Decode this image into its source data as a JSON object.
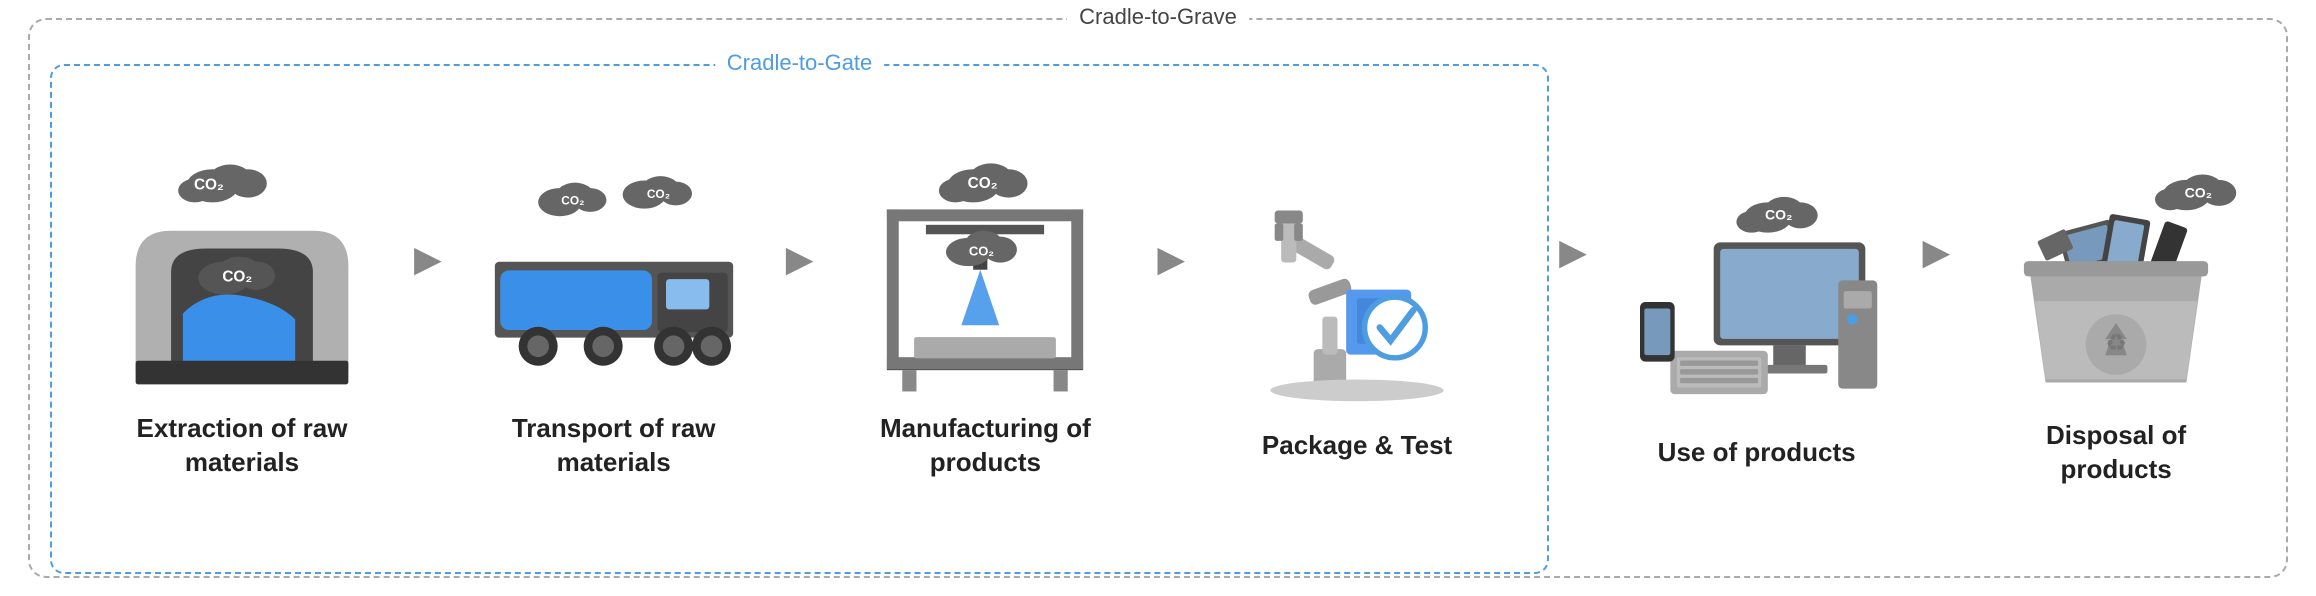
{
  "diagram": {
    "outer_label": "Cradle-to-Grave",
    "inner_label": "Cradle-to-Gate",
    "stages": [
      {
        "id": "extraction",
        "label": "Extraction of raw\nmaterials",
        "inside_gate": true
      },
      {
        "id": "transport",
        "label": "Transport of raw\nmaterials",
        "inside_gate": true
      },
      {
        "id": "manufacturing",
        "label": "Manufacturing of\nproducts",
        "inside_gate": true
      },
      {
        "id": "package-test",
        "label": "Package & Test",
        "inside_gate": true
      },
      {
        "id": "use",
        "label": "Use of products",
        "inside_gate": false
      },
      {
        "id": "disposal",
        "label": "Disposal of\nproducts",
        "inside_gate": false
      }
    ]
  }
}
